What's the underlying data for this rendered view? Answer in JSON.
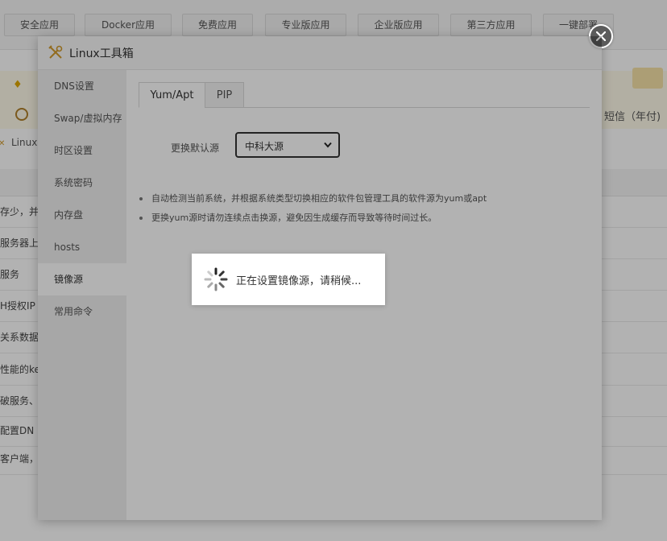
{
  "background": {
    "top_tabs": [
      "安全应用",
      "Docker应用",
      "免费应用",
      "专业版应用",
      "企业版应用",
      "第三方应用",
      "一键部署"
    ],
    "banner_right_text": "短信（年付)",
    "linux_label": "Linux",
    "rows": [
      "存少，并",
      "服务器上",
      "服务",
      "H授权IP",
      "关系数据库",
      "性能的key",
      "破服务、",
      "  配置DN",
      "客户端，"
    ]
  },
  "dialog": {
    "title": "Linux工具箱",
    "title_icon": "tools-icon",
    "close_icon": "close-icon",
    "sidebar": [
      {
        "label": "DNS设置"
      },
      {
        "label": "Swap/虚拟内存"
      },
      {
        "label": "时区设置"
      },
      {
        "label": "系统密码"
      },
      {
        "label": "内存盘"
      },
      {
        "label": "hosts"
      },
      {
        "label": "镜像源"
      },
      {
        "label": "常用命令"
      }
    ],
    "active_sidebar_index": 6,
    "tabs": [
      {
        "label": "Yum/Apt"
      },
      {
        "label": "PIP"
      }
    ],
    "active_tab_index": 0,
    "form": {
      "label": "更换默认源",
      "selected": "中科大源"
    },
    "notes": [
      "自动检测当前系统，并根据系统类型切换相应的软件包管理工具的软件源为yum或apt",
      "更换yum源时请勿连续点击换源，避免因生成缓存而导致等待时间过长。"
    ]
  },
  "loading": {
    "text": "正在设置镜像源，请稍候...",
    "icon": "spinner-icon"
  },
  "colors": {
    "overlay": "#000000",
    "accent_gold": "#d19b2e"
  }
}
